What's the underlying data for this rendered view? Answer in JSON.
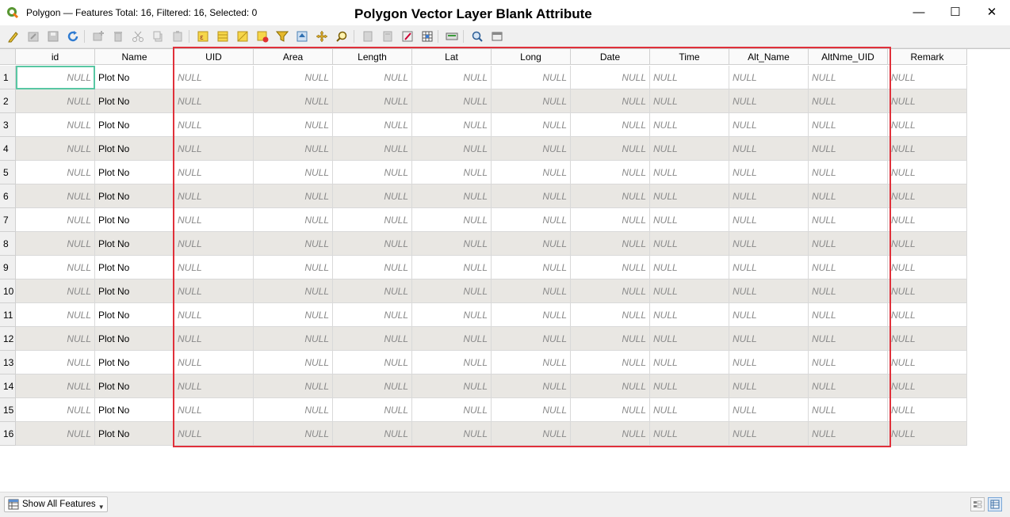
{
  "window": {
    "title": "Polygon — Features Total: 16, Filtered: 16, Selected: 0",
    "overlay_caption": "Polygon Vector Layer Blank Attribute",
    "minimize": "—",
    "maximize": "☐",
    "close": "✕"
  },
  "toolbar": {
    "icons": [
      "toggle-editing-icon",
      "multi-edit-icon",
      "save-edits-icon",
      "reload-icon",
      "add-feature-icon",
      "delete-feature-icon",
      "cut-icon",
      "copy-icon",
      "paste-icon",
      "select-by-expression-icon",
      "select-all-icon",
      "invert-selection-icon",
      "filter-icon",
      "deselect-icon",
      "move-selection-to-top-icon",
      "pan-to-selection-icon",
      "zoom-to-selection-icon",
      "new-field-icon",
      "delete-field-icon",
      "field-calculator-icon",
      "conditional-formatting-icon",
      "actions-icon",
      "dock-icon",
      "organize-columns-icon"
    ]
  },
  "table": {
    "columns": [
      "id",
      "Name",
      "UID",
      "Area",
      "Length",
      "Lat",
      "Long",
      "Date",
      "Time",
      "Alt_Name",
      "AltNme_UID",
      "Remark"
    ],
    "null_text": "NULL",
    "name_value": "Plot No",
    "rows": [
      "1",
      "2",
      "3",
      "4",
      "5",
      "6",
      "7",
      "8",
      "9",
      "10",
      "11",
      "12",
      "13",
      "14",
      "15",
      "16"
    ]
  },
  "statusbar": {
    "filter_button": "Show All Features"
  },
  "colors": {
    "highlight_box": "#e0303a",
    "focus_cell": "#58c7a3",
    "alt_row": "#e9e7e3"
  }
}
